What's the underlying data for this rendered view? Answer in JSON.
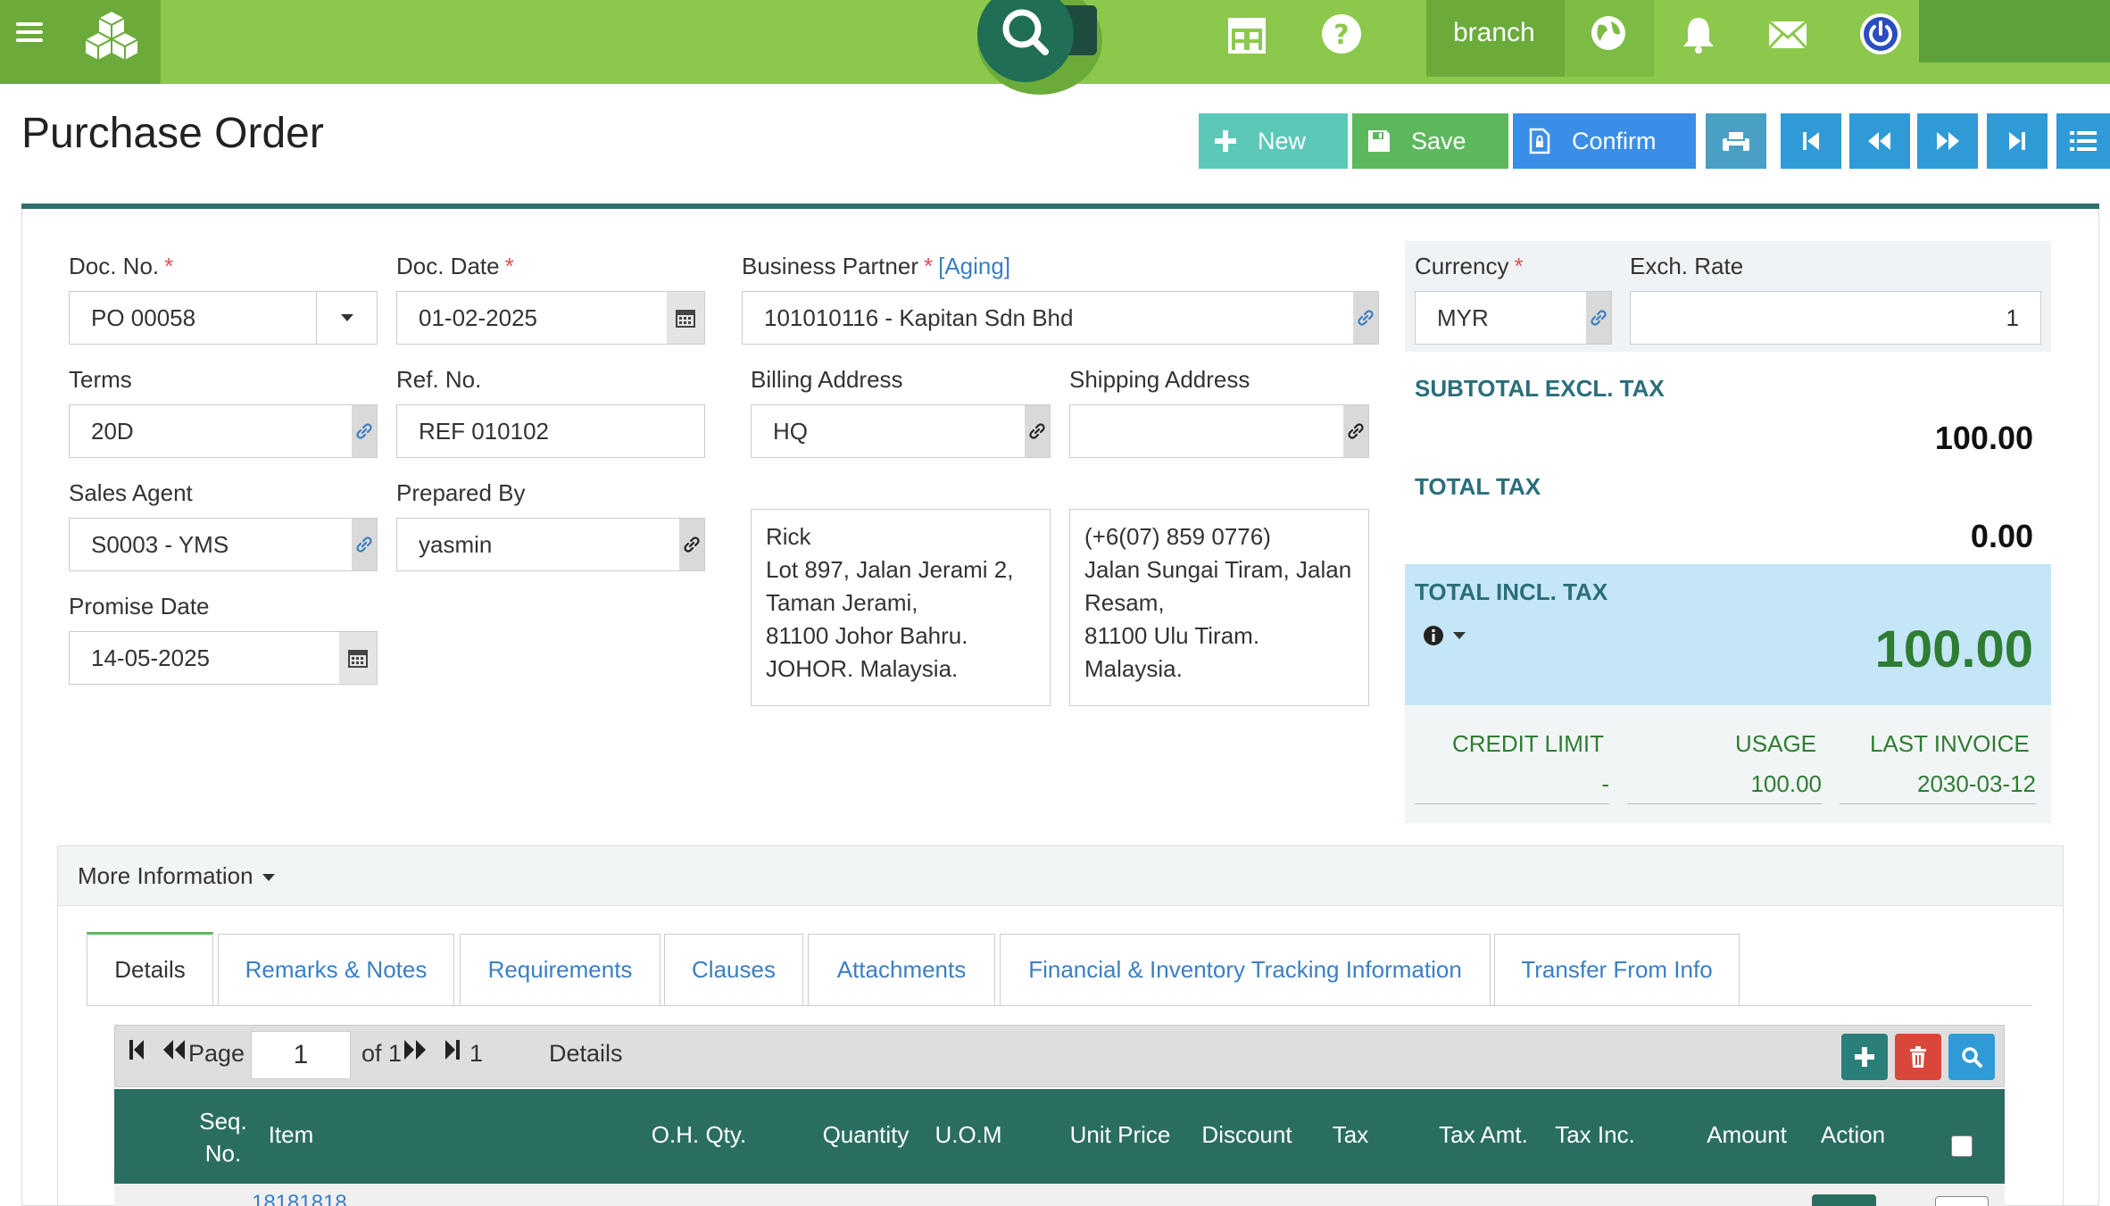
{
  "topbar": {
    "branch_label": "branch",
    "icons": [
      "menu-icon",
      "boxes-logo-icon",
      "search-icon",
      "store-icon",
      "help-icon",
      "globe-icon",
      "bell-icon",
      "mail-icon",
      "power-icon"
    ],
    "colors": {
      "bar": "#8cc84b",
      "dark": "#6aab3a",
      "search": "#1f6e55"
    }
  },
  "page": {
    "title": "Purchase Order"
  },
  "toolbar": {
    "new_label": "New",
    "save_label": "Save",
    "confirm_label": "Confirm",
    "icons": [
      "print-icon",
      "first-record-icon",
      "previous-record-icon",
      "next-record-icon",
      "last-record-icon",
      "list-icon"
    ]
  },
  "form": {
    "doc_no": {
      "label": "Doc. No.",
      "required": "*",
      "value": "PO 00058"
    },
    "doc_date": {
      "label": "Doc. Date",
      "required": "*",
      "value": "01-02-2025"
    },
    "business_partner": {
      "label": "Business Partner",
      "required": "*",
      "aging_link": "[Aging]",
      "value": "101010116 - Kapitan Sdn Bhd"
    },
    "terms": {
      "label": "Terms",
      "value": "20D"
    },
    "ref_no": {
      "label": "Ref. No.",
      "value": "REF 010102"
    },
    "billing_address": {
      "label": "Billing Address",
      "value": "HQ",
      "lines": [
        "Rick",
        "Lot 897, Jalan Jerami 2,",
        "Taman Jerami,",
        "81100 Johor Bahru.",
        "JOHOR. Malaysia."
      ]
    },
    "shipping_address": {
      "label": "Shipping Address",
      "value": "",
      "lines": [
        "(+6(07) 859 0776)",
        "Jalan Sungai Tiram, Jalan",
        "Resam,",
        "81100 Ulu Tiram.",
        "Malaysia."
      ]
    },
    "sales_agent": {
      "label": "Sales Agent",
      "value": "S0003 - YMS"
    },
    "prepared_by": {
      "label": "Prepared By",
      "value": "yasmin"
    },
    "promise_date": {
      "label": "Promise Date",
      "value": "14-05-2025"
    }
  },
  "summary": {
    "currency": {
      "label": "Currency",
      "required": "*",
      "value": "MYR"
    },
    "exch_rate": {
      "label": "Exch. Rate",
      "value": "1"
    },
    "subtotal_label": "SUBTOTAL EXCL. TAX",
    "subtotal_value": "100.00",
    "total_tax_label": "TOTAL TAX",
    "total_tax_value": "0.00",
    "total_incl_label": "TOTAL INCL. TAX",
    "total_incl_value": "100.00",
    "credit": {
      "limit_label": "CREDIT LIMIT",
      "limit_value": "-",
      "usage_label": "USAGE",
      "usage_value": "100.00",
      "last_invoice_label": "LAST INVOICE",
      "last_invoice_value": "2030-03-12"
    }
  },
  "more_info": {
    "label": "More Information"
  },
  "tabs": [
    "Details",
    "Remarks & Notes",
    "Requirements",
    "Clauses",
    "Attachments",
    "Financial & Inventory Tracking Information",
    "Transfer From Info"
  ],
  "grid": {
    "pager": {
      "page_label": "Page",
      "page_value": "1",
      "of_label": "of 1",
      "last_value": "1",
      "section_title": "Details"
    },
    "columns": [
      "Seq.\nNo.",
      "Item",
      "O.H. Qty.",
      "Quantity",
      "U.O.M",
      "Unit Price",
      "Discount",
      "Tax",
      "Tax Amt.",
      "Tax Inc.",
      "Amount",
      "Action"
    ],
    "rows": [
      {
        "item": "18181818"
      }
    ]
  }
}
